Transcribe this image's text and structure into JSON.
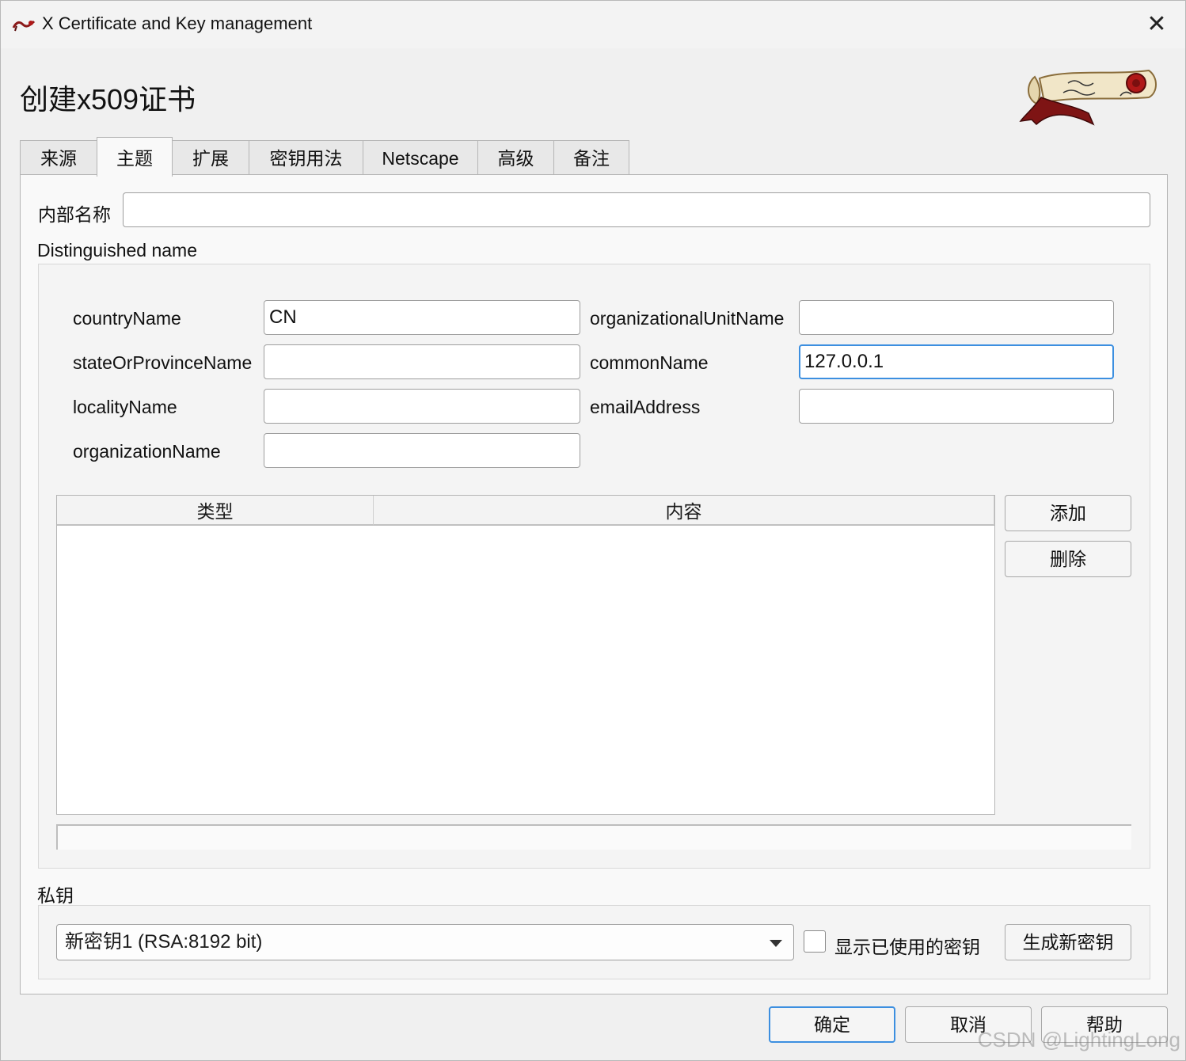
{
  "window": {
    "title": "X Certificate and Key management",
    "close_glyph": "✕",
    "app_icon": "xca-scroll-icon"
  },
  "page_title": "创建x509证书",
  "tabs": [
    {
      "label": "来源",
      "active": false
    },
    {
      "label": "主题",
      "active": true
    },
    {
      "label": "扩展",
      "active": false
    },
    {
      "label": "密钥用法",
      "active": false
    },
    {
      "label": "Netscape",
      "active": false
    },
    {
      "label": "高级",
      "active": false
    },
    {
      "label": "备注",
      "active": false
    }
  ],
  "subject": {
    "internal_name_label": "内部名称",
    "internal_name_value": "",
    "dn_group_label": "Distinguished name",
    "fields": {
      "countryName": {
        "label": "countryName",
        "value": "CN"
      },
      "stateOrProvinceName": {
        "label": "stateOrProvinceName",
        "value": ""
      },
      "localityName": {
        "label": "localityName",
        "value": ""
      },
      "organizationName": {
        "label": "organizationName",
        "value": ""
      },
      "organizationalUnitName": {
        "label": "organizationalUnitName",
        "value": ""
      },
      "commonName": {
        "label": "commonName",
        "value": "127.0.0.1"
      },
      "emailAddress": {
        "label": "emailAddress",
        "value": ""
      }
    },
    "table": {
      "columns": [
        "类型",
        "内容"
      ],
      "rows": []
    },
    "add_button": "添加",
    "delete_button": "删除"
  },
  "private_key": {
    "group_label": "私钥",
    "selected_key": "新密钥1 (RSA:8192 bit)",
    "show_used_keys_label": "显示已使用的密钥",
    "show_used_keys_checked": false,
    "generate_button": "生成新密钥"
  },
  "footer": {
    "ok_button": "确定",
    "cancel_button": "取消",
    "help_button": "帮助"
  },
  "watermark": "CSDN @LightingLong",
  "colors": {
    "focus_accent": "#3c8fe0",
    "window_bg": "#f0f0f0",
    "panel_bg": "#f9f9f9"
  }
}
